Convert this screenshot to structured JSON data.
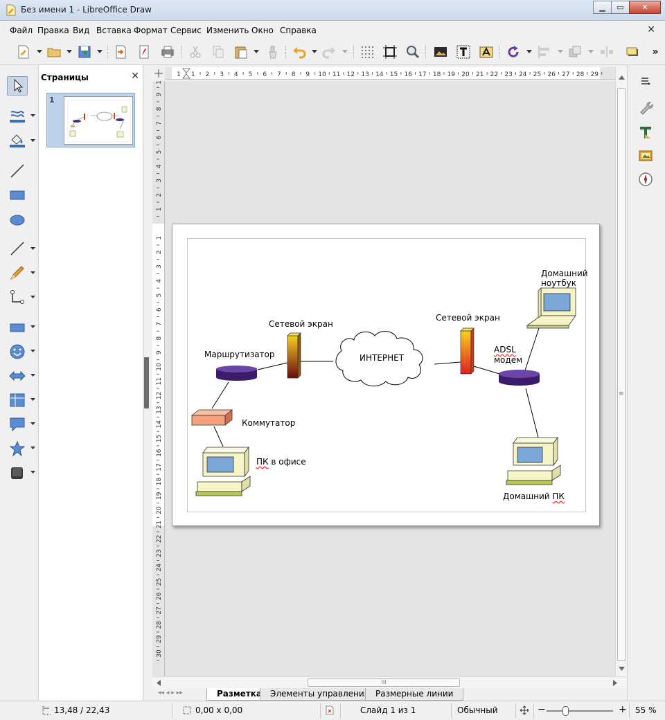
{
  "window": {
    "title": "Без имени 1 - LibreOffice Draw",
    "minimize": "▁",
    "maximize": "▭",
    "close": "✕"
  },
  "menu": {
    "items": [
      "Файл",
      "Правка",
      "Вид",
      "Вставка",
      "Формат",
      "Сервис",
      "Изменить",
      "Окно",
      "Справка"
    ],
    "doc_close": "✕"
  },
  "pages_panel": {
    "title": "Страницы",
    "close": "✕",
    "page_number": "1"
  },
  "hruler": {
    "ticks": [
      "1",
      "1",
      "2",
      "3",
      "4",
      "5",
      "6",
      "7",
      "8",
      "9",
      "10",
      "11",
      "12",
      "13",
      "14",
      "15",
      "16",
      "17",
      "18",
      "19",
      "20",
      "21",
      "22",
      "23",
      "24",
      "25",
      "26",
      "27",
      "28",
      "29"
    ]
  },
  "vruler": {
    "ticks_top": [
      "10",
      "9",
      "8",
      "7",
      "6",
      "5",
      "4",
      "3",
      "2",
      "1"
    ],
    "ticks_bottom": [
      "1",
      "2",
      "3",
      "4",
      "5",
      "6",
      "7",
      "8",
      "9",
      "10",
      "11",
      "12",
      "13",
      "14",
      "15",
      "16",
      "17",
      "18",
      "19",
      "20",
      "21",
      "22",
      "23",
      "24",
      "25",
      "26",
      "27",
      "28",
      "29",
      "30"
    ]
  },
  "diagram": {
    "labels": {
      "router": "Маршрутизатор",
      "firewall_left": "Сетевой экран",
      "internet": "ИНТЕРНЕТ",
      "firewall_right": "Сетевой экран",
      "adsl_1": "ADSL",
      "adsl_2": "модем",
      "laptop_1": "Домашний",
      "laptop_2": "ноутбук",
      "switch": "Коммутатор",
      "office_pc_abbr": "ПК",
      "office_pc_rest": " в офисе",
      "home_pc_rest": "Домашний ",
      "home_pc_abbr": "ПК"
    }
  },
  "hscroll": {
    "grip": "III"
  },
  "vscroll": {
    "grip": "≡"
  },
  "tabs": {
    "nav": "◂◂  ◂  ▸  ▸▸",
    "items": [
      "Разметка",
      "Элементы управления",
      "Размерные линии"
    ]
  },
  "status": {
    "position": "13,48 / 22,43",
    "size": "0,00 x 0,00",
    "slide": "Слайд 1 из 1",
    "layout": "Обычный",
    "zoom_minus": "−",
    "zoom_plus": "+",
    "zoom": "55 %"
  },
  "colors": {
    "accent": "#3c6eb4",
    "router": "#4b2a82",
    "firewall": "#d2141e",
    "switch": "#f5a07a",
    "pc_body": "#f5f5c8",
    "pc_screen": "#7aa7d8"
  }
}
